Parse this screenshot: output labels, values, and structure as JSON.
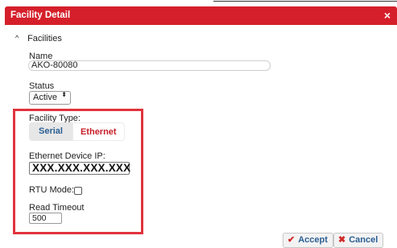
{
  "dialog": {
    "title": "Facility Detail",
    "close_icon": "close-icon",
    "close_glyph": "×"
  },
  "section": {
    "caret_glyph": "^",
    "label": "Facilities"
  },
  "fields": {
    "name_label": "Name",
    "name_value": "AKO-80080",
    "status_label": "Status",
    "status_value": "Active",
    "status_spin_glyph": "⬍",
    "facility_type_label": "Facility Type:",
    "facility_type_options": [
      "Serial",
      "Ethernet"
    ],
    "ethernet_ip_label": "Ethernet Device IP:",
    "ethernet_ip_value": "XXX.XXX.XXX.XXX",
    "rtu_mode_label": "RTU Mode:",
    "rtu_mode_checked": false,
    "read_timeout_label": "Read Timeout",
    "read_timeout_value": "500"
  },
  "footer": {
    "accept_label": "Accept",
    "accept_icon_glyph": "✔",
    "cancel_label": "Cancel",
    "cancel_icon_glyph": "✖"
  },
  "colors": {
    "titlebar": "#d51f2a",
    "highlight_border": "#e0333c",
    "button_text": "#2b5e93",
    "ethernet_text": "#c81e28"
  }
}
